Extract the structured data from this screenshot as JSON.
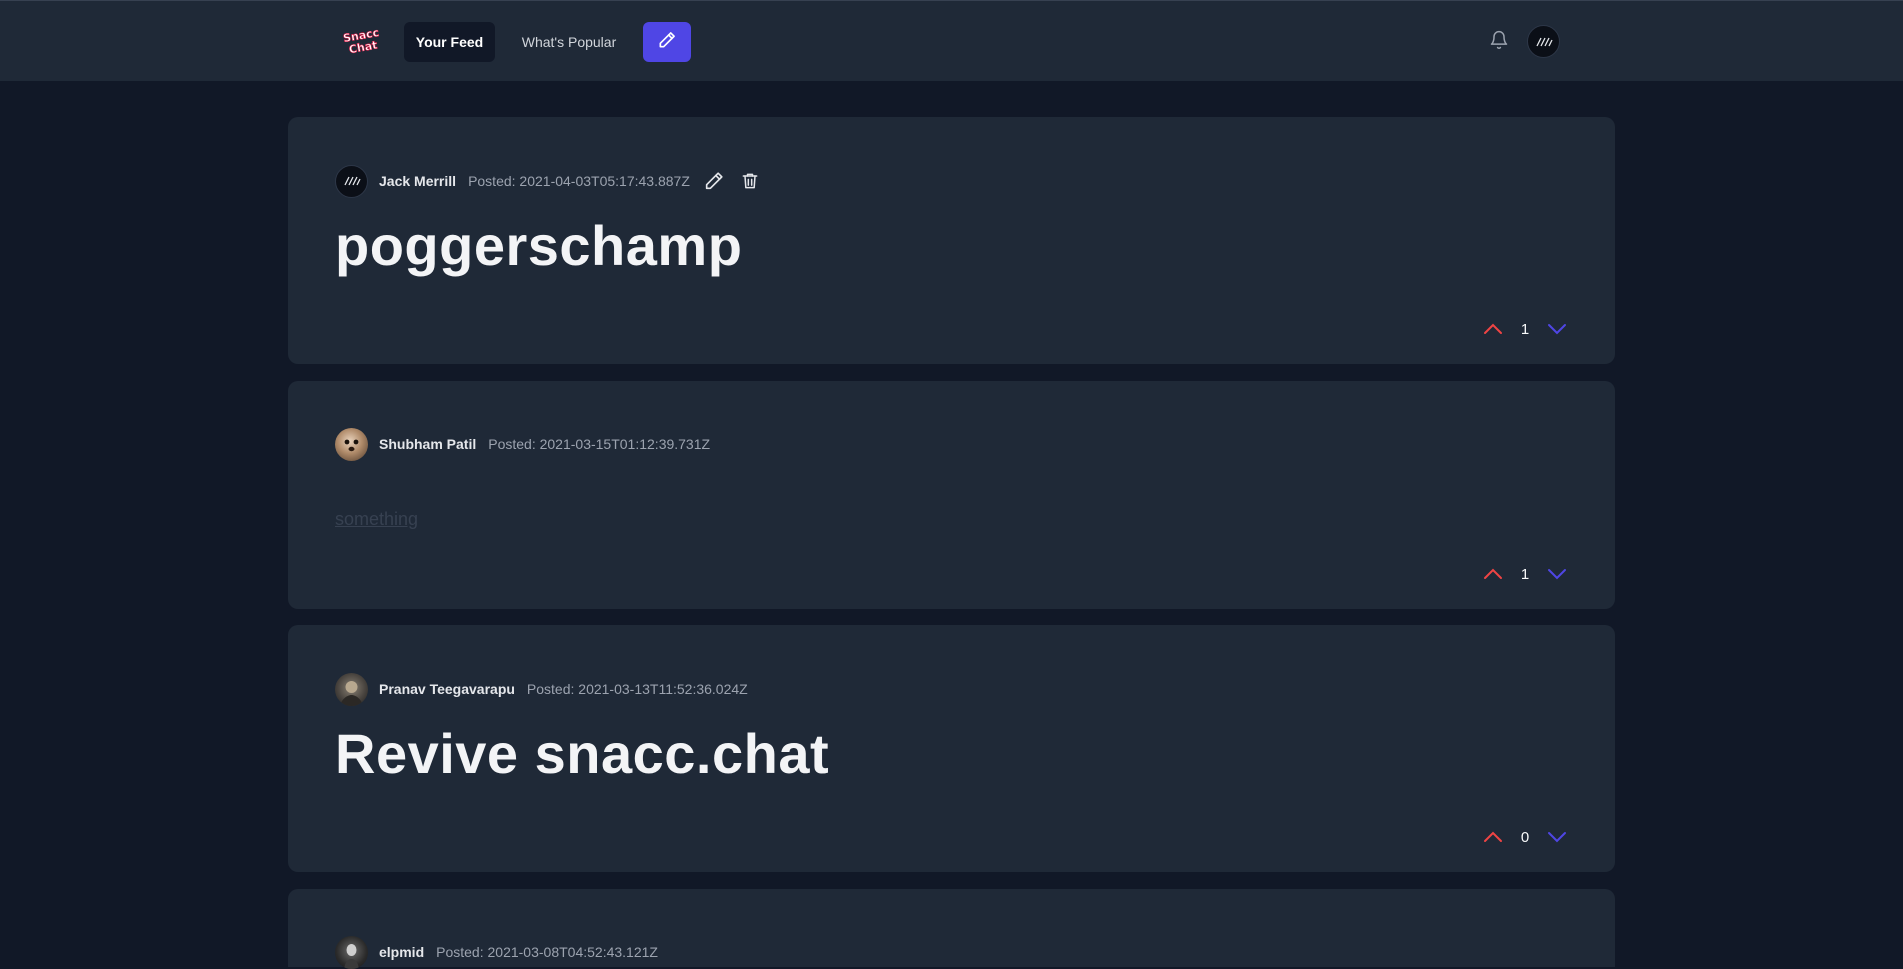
{
  "nav": {
    "logo_text": "Snacc Chat",
    "tabs": [
      {
        "label": "Your Feed",
        "active": true
      },
      {
        "label": "What's Popular",
        "active": false
      }
    ],
    "compose_icon": "pencil-icon",
    "notification_icon": "bell-icon",
    "colors": {
      "bar": "#1f2937",
      "accent": "#4f46e5"
    }
  },
  "posts": [
    {
      "author": "Jack Merrill",
      "posted": "Posted: 2021-04-03T05:17:43.887Z",
      "title": "poggerschamp",
      "body": "",
      "votes": "1",
      "editable": true
    },
    {
      "author": "Shubham Patil",
      "posted": "Posted: 2021-03-15T01:12:39.731Z",
      "title": "",
      "body": "something",
      "votes": "1",
      "editable": false
    },
    {
      "author": "Pranav Teegavarapu",
      "posted": "Posted: 2021-03-13T11:52:36.024Z",
      "title": "Revive snacc.chat",
      "body": "",
      "votes": "0",
      "editable": false
    },
    {
      "author": "elpmid",
      "posted": "Posted: 2021-03-08T04:52:43.121Z",
      "title": "",
      "body": "",
      "votes": "",
      "editable": false
    }
  ],
  "colors": {
    "page": "#111827",
    "card": "#1f2937",
    "upvote": "#ef4444",
    "downvote": "#4f46e5"
  }
}
